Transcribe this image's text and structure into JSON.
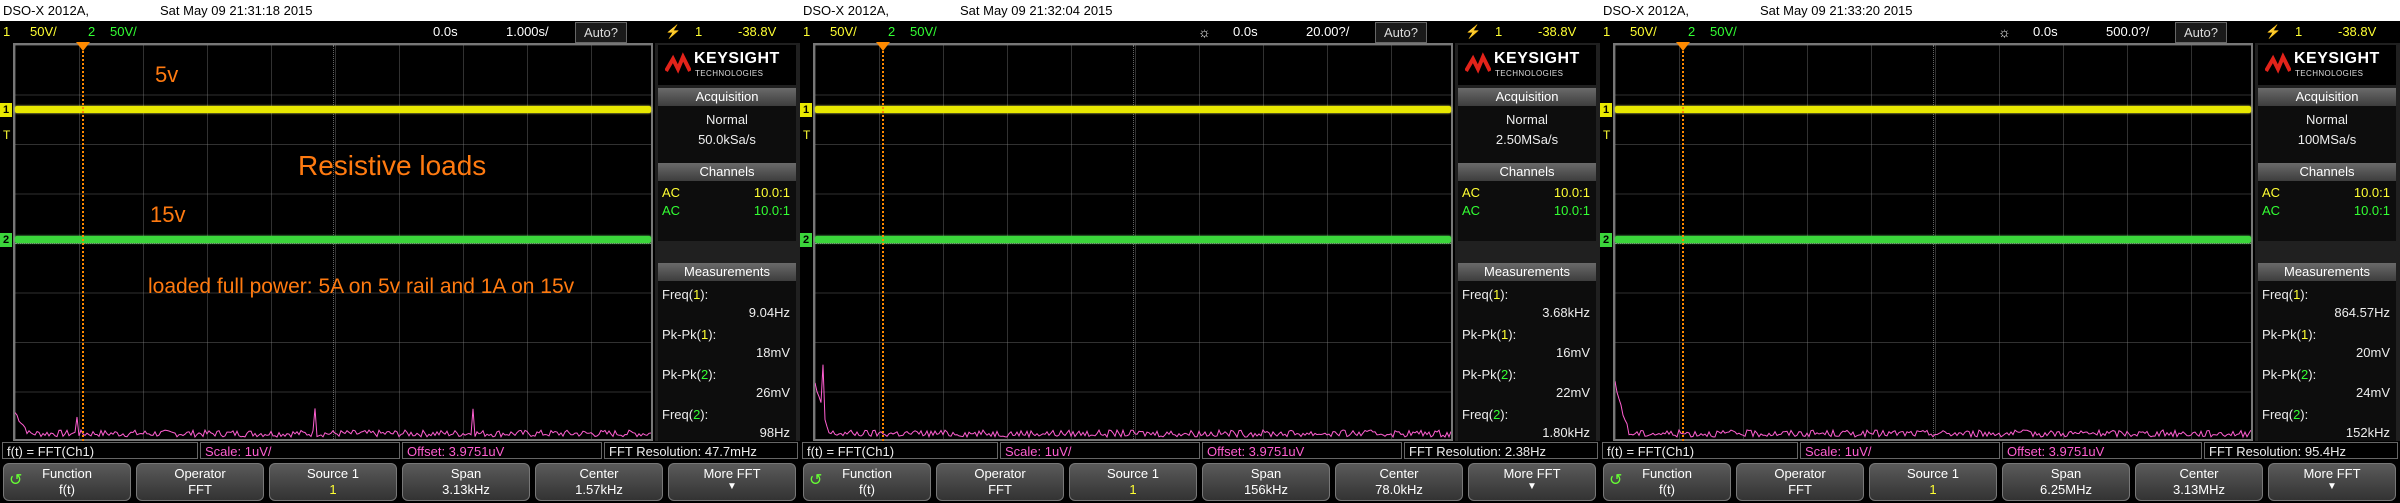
{
  "screens": [
    {
      "model": "DSO-X 2012A,",
      "date": "Sat May 09 21:31:18 2015",
      "ch1_num": "1",
      "ch1_scale": "50V/",
      "ch2_num": "2",
      "ch2_scale": "50V/",
      "hpos": "0.0s",
      "tdiv": "1.000s/",
      "trig_mode": "Auto?",
      "trig_symbol": "⚡",
      "trig_ch": "1",
      "trig_level": "-38.8V",
      "show_gear": "",
      "acq_title": "Acquisition",
      "acq_mode": "Normal",
      "acq_rate": "50.0kSa/s",
      "chan_title": "Channels",
      "channels": [
        {
          "coupling": "AC",
          "probe": "10.0:1"
        },
        {
          "coupling": "AC",
          "probe": "10.0:1"
        }
      ],
      "meas_title": "Measurements",
      "measurements": [
        {
          "name": "Freq(",
          "src": "1",
          "close": "):",
          "value": "9.04Hz"
        },
        {
          "name": "Pk-Pk(",
          "src": "1",
          "close": "):",
          "value": "18mV"
        },
        {
          "name": "Pk-Pk(",
          "src": "2",
          "close": "):",
          "value": "26mV"
        },
        {
          "name": "Freq(",
          "src": "2",
          "close": "):",
          "value": "98Hz"
        }
      ],
      "fft_fn": "f(t) = FFT(Ch1)",
      "fft_scale": "Scale: 1uV/",
      "fft_offset": "Offset: 3.9751uV",
      "fft_res": "FFT Resolution: 47.7mHz",
      "keys": [
        {
          "label": "Function",
          "value": "f(t)"
        },
        {
          "label": "Operator",
          "value": "FFT"
        },
        {
          "label": "Source 1",
          "value": "1"
        },
        {
          "label": "Span",
          "value": "3.13kHz"
        },
        {
          "label": "Center",
          "value": "1.57kHz"
        },
        {
          "label": "More FFT",
          "value": ""
        }
      ],
      "annotations": {
        "a5v": "5v",
        "a15v": "15v",
        "title": "Resistive loads",
        "note": "loaded full power: 5A on 5v rail and 1A on 15v"
      }
    },
    {
      "model": "DSO-X 2012A,",
      "date": "Sat May 09 21:32:04 2015",
      "ch1_num": "1",
      "ch1_scale": "50V/",
      "ch2_num": "2",
      "ch2_scale": "50V/",
      "hpos": "0.0s",
      "tdiv": "20.00?/",
      "trig_mode": "Auto?",
      "trig_symbol": "⚡",
      "trig_ch": "1",
      "trig_level": "-38.8V",
      "show_gear": "☼",
      "acq_title": "Acquisition",
      "acq_mode": "Normal",
      "acq_rate": "2.50MSa/s",
      "chan_title": "Channels",
      "channels": [
        {
          "coupling": "AC",
          "probe": "10.0:1"
        },
        {
          "coupling": "AC",
          "probe": "10.0:1"
        }
      ],
      "meas_title": "Measurements",
      "measurements": [
        {
          "name": "Freq(",
          "src": "1",
          "close": "):",
          "value": "3.68kHz"
        },
        {
          "name": "Pk-Pk(",
          "src": "1",
          "close": "):",
          "value": "16mV"
        },
        {
          "name": "Pk-Pk(",
          "src": "2",
          "close": "):",
          "value": "22mV"
        },
        {
          "name": "Freq(",
          "src": "2",
          "close": "):",
          "value": "1.80kHz"
        }
      ],
      "fft_fn": "f(t) = FFT(Ch1)",
      "fft_scale": "Scale: 1uV/",
      "fft_offset": "Offset: 3.9751uV",
      "fft_res": "FFT Resolution: 2.38Hz",
      "keys": [
        {
          "label": "Function",
          "value": "f(t)"
        },
        {
          "label": "Operator",
          "value": "FFT"
        },
        {
          "label": "Source 1",
          "value": "1"
        },
        {
          "label": "Span",
          "value": "156kHz"
        },
        {
          "label": "Center",
          "value": "78.0kHz"
        },
        {
          "label": "More FFT",
          "value": ""
        }
      ],
      "annotations": null
    },
    {
      "model": "DSO-X 2012A,",
      "date": "Sat May 09 21:33:20 2015",
      "ch1_num": "1",
      "ch1_scale": "50V/",
      "ch2_num": "2",
      "ch2_scale": "50V/",
      "hpos": "0.0s",
      "tdiv": "500.0?/",
      "trig_mode": "Auto?",
      "trig_symbol": "⚡",
      "trig_ch": "1",
      "trig_level": "-38.8V",
      "show_gear": "☼",
      "acq_title": "Acquisition",
      "acq_mode": "Normal",
      "acq_rate": "100MSa/s",
      "chan_title": "Channels",
      "channels": [
        {
          "coupling": "AC",
          "probe": "10.0:1"
        },
        {
          "coupling": "AC",
          "probe": "10.0:1"
        }
      ],
      "meas_title": "Measurements",
      "measurements": [
        {
          "name": "Freq(",
          "src": "1",
          "close": "):",
          "value": "864.57Hz"
        },
        {
          "name": "Pk-Pk(",
          "src": "1",
          "close": "):",
          "value": "20mV"
        },
        {
          "name": "Pk-Pk(",
          "src": "2",
          "close": "):",
          "value": "24mV"
        },
        {
          "name": "Freq(",
          "src": "2",
          "close": "):",
          "value": "152kHz"
        }
      ],
      "fft_fn": "f(t) = FFT(Ch1)",
      "fft_scale": "Scale: 1uV/",
      "fft_offset": "Offset: 3.9751uV",
      "fft_res": "FFT Resolution: 95.4Hz",
      "keys": [
        {
          "label": "Function",
          "value": "f(t)"
        },
        {
          "label": "Operator",
          "value": "FFT"
        },
        {
          "label": "Source 1",
          "value": "1"
        },
        {
          "label": "Span",
          "value": "6.25MHz"
        },
        {
          "label": "Center",
          "value": "3.13MHz"
        },
        {
          "label": "More FFT",
          "value": ""
        }
      ],
      "annotations": null
    }
  ],
  "brand": {
    "name": "KEYSIGHT",
    "sub": "TECHNOLOGIES",
    "logo_icon": "keysight-wave-icon"
  },
  "colors": {
    "ch1": "#e8e800",
    "ch2": "#3bd63b",
    "math": "#ff5fd1",
    "trigger": "#ff8a00",
    "annotation": "#ff7a10"
  }
}
